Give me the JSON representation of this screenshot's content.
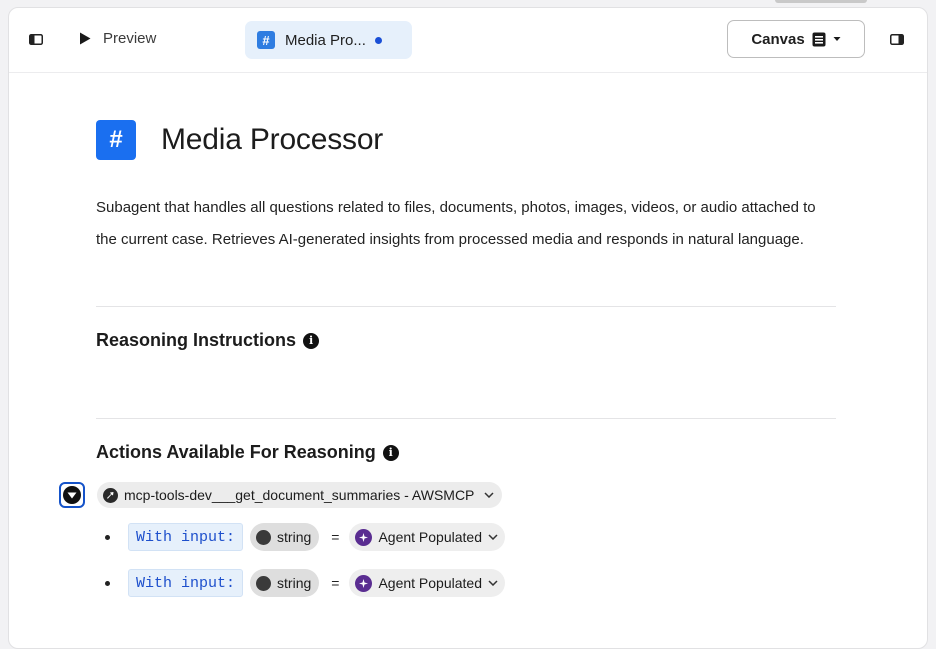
{
  "toolbar": {
    "preview_label": "Preview",
    "tab_label": "Media Pro...",
    "tab_icon": "#",
    "canvas_label": "Canvas"
  },
  "header": {
    "icon": "#",
    "title": "Media Processor"
  },
  "description": "Subagent that handles all questions related to files, documents, photos, images, videos, or audio attached to the current case. Retrieves AI-generated insights from processed media and responds in natural language.",
  "sections": {
    "reasoning_title": "Reasoning Instructions",
    "actions_title": "Actions Available For Reasoning"
  },
  "action": {
    "tool_name": "mcp-tools-dev___get_document_summaries - AWSMCP",
    "inputs": [
      {
        "label": "With input:",
        "type": "string",
        "equals": "=",
        "source": "Agent Populated"
      },
      {
        "label": "With input:",
        "type": "string",
        "equals": "=",
        "source": "Agent Populated"
      }
    ]
  },
  "colors": {
    "accent": "#1a6ff0",
    "tab_bg": "#e6f0fb",
    "dirty_dot": "#1a4fd6",
    "agent_icon": "#5a2d91",
    "focus_ring": "#1553c9"
  }
}
